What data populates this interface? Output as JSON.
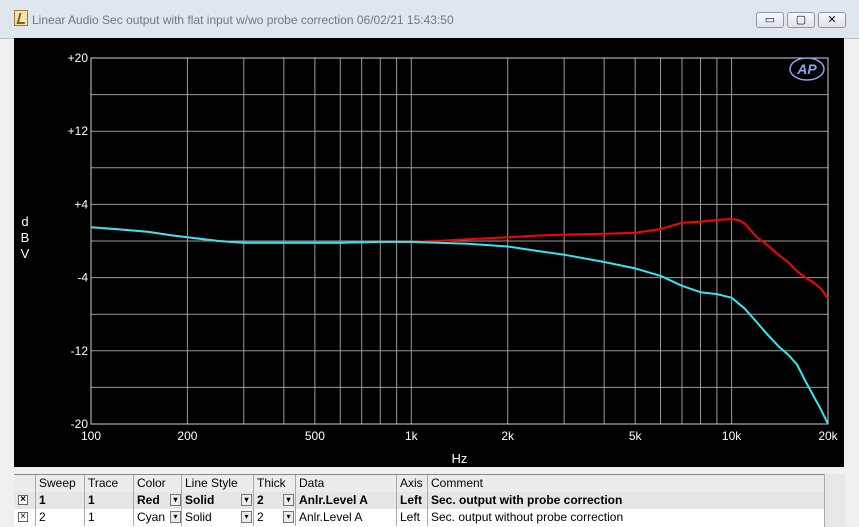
{
  "window": {
    "title": "Linear Audio  Sec output with flat input w/wo probe correction  06/02/21 15:43:50",
    "min_glyph": "▭",
    "max_glyph": "▢",
    "close_glyph": "✕",
    "icons": [
      "app-icon",
      "minimize-icon",
      "maximize-icon",
      "close-icon",
      "ap-logo-icon",
      "checkbox-icon",
      "dropdown-arrow-icon"
    ]
  },
  "chart_data": {
    "type": "line",
    "xlabel": "Hz",
    "ylabel": "d\nB\nV",
    "xscale": "log",
    "xlim": [
      100,
      20000
    ],
    "ylim": [
      -20,
      20
    ],
    "x_ticks": [
      100,
      200,
      500,
      1000,
      2000,
      5000,
      10000,
      20000
    ],
    "x_tick_labels": [
      "100",
      "200",
      "500",
      "1k",
      "2k",
      "5k",
      "10k",
      "20k"
    ],
    "y_ticks": [
      20,
      12,
      4,
      -4,
      -12,
      -20
    ],
    "y_tick_labels": [
      "+20",
      "+12",
      "+4",
      "-4",
      "-12",
      "-20"
    ],
    "grid": true,
    "logo_text": "AP",
    "series": [
      {
        "name": "Sec. output with probe correction",
        "color": "#ff0000",
        "x": [
          100,
          120,
          150,
          180,
          200,
          250,
          300,
          400,
          500,
          600,
          800,
          1000,
          1200,
          1500,
          2000,
          2500,
          3000,
          4000,
          5000,
          6000,
          7000,
          8000,
          9000,
          10000,
          10500,
          11000,
          12000,
          13000,
          14000,
          15000,
          16000,
          17000,
          18000,
          19000,
          20000
        ],
        "y": [
          1.5,
          1.3,
          1.0,
          0.6,
          0.4,
          0.0,
          -0.2,
          -0.2,
          -0.2,
          -0.2,
          -0.1,
          -0.1,
          0.0,
          0.2,
          0.4,
          0.6,
          0.7,
          0.8,
          0.9,
          1.3,
          2.0,
          2.1,
          2.3,
          2.4,
          2.3,
          1.9,
          0.4,
          -0.5,
          -1.5,
          -2.3,
          -3.3,
          -4.0,
          -4.5,
          -5.2,
          -6.3
        ]
      },
      {
        "name": "Sec. output without probe correction",
        "color": "#33e6f0",
        "x": [
          100,
          120,
          150,
          180,
          200,
          250,
          300,
          400,
          500,
          600,
          800,
          1000,
          1200,
          1500,
          2000,
          2500,
          3000,
          4000,
          5000,
          6000,
          7000,
          8000,
          9000,
          10000,
          11000,
          12000,
          13000,
          14000,
          15000,
          16000,
          17000,
          18000,
          19000,
          20000
        ],
        "y": [
          1.5,
          1.3,
          1.0,
          0.6,
          0.4,
          0.0,
          -0.2,
          -0.2,
          -0.2,
          -0.2,
          -0.1,
          -0.1,
          -0.2,
          -0.3,
          -0.6,
          -1.1,
          -1.5,
          -2.3,
          -3.0,
          -3.8,
          -4.9,
          -5.6,
          -5.8,
          -6.2,
          -7.4,
          -8.9,
          -10.3,
          -11.5,
          -12.4,
          -13.5,
          -15.3,
          -16.9,
          -18.4,
          -20.0
        ]
      }
    ]
  },
  "table": {
    "headers": {
      "sweep": "Sweep",
      "trace": "Trace",
      "color": "Color",
      "line_style": "Line Style",
      "thick": "Thick",
      "data": "Data",
      "axis": "Axis",
      "comment": "Comment"
    },
    "rows": [
      {
        "checked": "×",
        "sweep": "1",
        "trace": "1",
        "color": "Red",
        "line_style": "Solid",
        "thick": "2",
        "data": "Anlr.Level A",
        "axis": "Left",
        "comment": "Sec. output with probe correction"
      },
      {
        "checked": "×",
        "sweep": "2",
        "trace": "1",
        "color": "Cyan",
        "line_style": "Solid",
        "thick": "2",
        "data": "Anlr.Level A",
        "axis": "Left",
        "comment": "Sec. output without probe correction"
      }
    ]
  }
}
